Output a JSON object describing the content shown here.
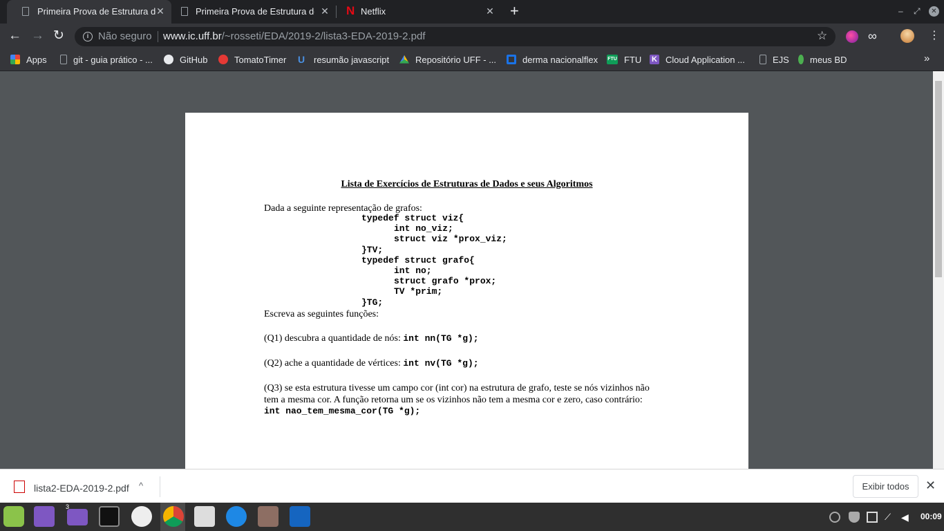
{
  "browser": {
    "tabs": [
      {
        "title": "Primeira Prova de Estrutura de",
        "close": "✕"
      },
      {
        "title": "Primeira Prova de Estrutura de",
        "close": "✕"
      },
      {
        "title": "Netflix",
        "close": "✕"
      }
    ],
    "new_tab": "+",
    "window_controls": {
      "minimize": "–",
      "restore": "⤢",
      "close": "✕"
    },
    "nav": {
      "back": "←",
      "forward": "→",
      "reload": "↻"
    },
    "omnibox": {
      "security": "Não seguro",
      "url_host": "www.ic.uff.br",
      "url_path": "/~rosseti/EDA/2019-2/lista3-EDA-2019-2.pdf"
    },
    "bookmarks": [
      {
        "label": "Apps",
        "icon": "apps-grid-icon",
        "color": "#e8453c"
      },
      {
        "label": "git - guia prático - ...",
        "icon": "page-icon",
        "color": "#9aa0a6"
      },
      {
        "label": "GitHub",
        "icon": "github-icon",
        "color": "#e8eaed"
      },
      {
        "label": "TomatoTimer",
        "icon": "tomato-icon",
        "color": "#e53935"
      },
      {
        "label": "resumão javascript",
        "icon": "u-logo-icon",
        "color": "#1a73e8"
      },
      {
        "label": "Repositório UFF - ...",
        "icon": "drive-icon",
        "color": "#fbbc04"
      },
      {
        "label": "derma nacionalflex",
        "icon": "grid-logo-icon",
        "color": "#1a73e8"
      },
      {
        "label": "FTU",
        "icon": "ftu-icon",
        "color": "#0f9d58"
      },
      {
        "label": "Cloud Application ...",
        "icon": "k-logo-icon",
        "color": "#7e57c2"
      },
      {
        "label": "EJS",
        "icon": "page-icon",
        "color": "#9aa0a6"
      },
      {
        "label": "meus BD",
        "icon": "leaf-icon",
        "color": "#4caf50"
      }
    ],
    "bookmarks_more": "»"
  },
  "document": {
    "title": "Lista de Exercícios de Estruturas de Dados e seus Algoritmos",
    "intro": "Dada a seguinte representação de grafos:",
    "code_lines": [
      {
        "text": "typedef struct viz{",
        "indent": 0
      },
      {
        "text": "int no_viz;",
        "indent": 1
      },
      {
        "text": "struct viz *prox_viz;",
        "indent": 1
      },
      {
        "text": "}TV;",
        "indent": 0
      },
      {
        "text": "typedef struct grafo{",
        "indent": 0
      },
      {
        "text": "int no;",
        "indent": 1
      },
      {
        "text": "struct grafo *prox;",
        "indent": 1
      },
      {
        "text": "TV *prim;",
        "indent": 1
      },
      {
        "text": "}TG;",
        "indent": 0
      }
    ],
    "instruction": "Escreva as seguintes funções:",
    "q1_text": "(Q1) descubra a quantidade de nós: ",
    "q1_code": "int nn(TG *g);",
    "q2_text": "(Q2) ache a quantidade de vértices: ",
    "q2_code": "int nv(TG *g);",
    "q3_line1": "(Q3) se esta estrutura tivesse um campo cor (int cor) na estrutura de grafo, teste se nós vizinhos não",
    "q3_line2": "tem a mesma cor. A função retorna um se os vizinhos não tem  a mesma cor e zero, caso contrário:",
    "q3_code": "int nao_tem_mesma_cor(TG *g);"
  },
  "download_bar": {
    "file": "lista2-EDA-2019-2.pdf",
    "chevron": "^",
    "show_all": "Exibir todos",
    "close": "✕"
  },
  "taskbar": {
    "files_badge": "3",
    "clock": "00:09"
  }
}
